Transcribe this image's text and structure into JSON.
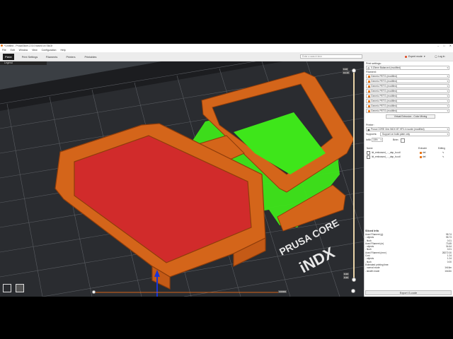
{
  "window": {
    "title": "*Untitled - PrusaSlicer-2.5.0 based on Slic3r",
    "controls": [
      "–",
      "□",
      "✕"
    ]
  },
  "menu": [
    "File",
    "Edit",
    "Window",
    "View",
    "Configuration",
    "Help"
  ],
  "tabs": [
    {
      "label": "Plater",
      "active": true
    },
    {
      "label": "Print Settings",
      "active": false
    },
    {
      "label": "Filaments",
      "active": false
    },
    {
      "label": "Printers",
      "active": false
    },
    {
      "label": "Printables",
      "active": false
    }
  ],
  "search": {
    "placeholder": "Enter a search term"
  },
  "mode": {
    "label": "Expert mode",
    "color": "#e0461d"
  },
  "login": {
    "label": "Log in"
  },
  "viewport": {
    "legend": "Legend",
    "bed_text_brand": "PRUSA CORE",
    "bed_text_model": "iNDX",
    "slider_top": "0.20",
    "slider_top2": "13.40",
    "slider_bottom": "0.20",
    "slider_bottom2": "0.20",
    "horizontal_value": "100000",
    "colors": {
      "bed": "#2a2c30",
      "grid": "#5a5d62",
      "part": "#d4651a",
      "fill": "#d12b2b",
      "support": "#3ee61a"
    }
  },
  "sidebar": {
    "print_settings_label": "Print settings:",
    "print_profile": "0.20mm Balanced (modified)",
    "filament_label": "Filament:",
    "filaments": [
      "Generic PETG (modified)",
      "Generic PETG (modified)",
      "Generic PETG (modified)",
      "Generic PETG (modified)",
      "Generic PETG (modified)",
      "Generic PETG (modified)",
      "Generic PETG (modified)",
      "Generic PETG (modified)"
    ],
    "virtual_extrusion_button": "Virtual Extrusion - Color Mixing",
    "printer_label": "Printer:",
    "printer_profile": "Prusa CORE One INDX 8T HF0.4 nozzle (modified)",
    "supports_label": "Supports:",
    "supports_value": "Support on build plate only",
    "infill_label": "Infill:",
    "infill_value": "15%",
    "brim_label": "Brim:",
    "objects_header": {
      "name": "Name",
      "extruder": "Extruder",
      "editing": "Editing"
    },
    "objects": [
      {
        "name": "lid_embossed_..._dap_bu.stl",
        "extruder": "def.",
        "extruder_color": "#e8771b"
      },
      {
        "name": "lid_embossed_..._dap_bu.stl",
        "extruder": "def.",
        "extruder_color": "#e8771b"
      }
    ]
  },
  "sliced_info": {
    "title": "Sliced Info",
    "rows": [
      {
        "label": "Used Filament (g)",
        "value": "98.74"
      },
      {
        "label": "- objects",
        "value": "98.73"
      },
      {
        "label": "- flush",
        "value": "0.01"
      },
      {
        "label": "Used Filament (m)",
        "value": "73.65"
      },
      {
        "label": "- objects",
        "value": "34.64"
      },
      {
        "label": "- flush",
        "value": "0.01"
      },
      {
        "label": "Used Filament (mm³)",
        "value": "28272.00"
      },
      {
        "label": "Cost",
        "value": "1.24"
      },
      {
        "label": "- objects",
        "value": "1.24"
      },
      {
        "label": "- flush",
        "value": "0.00"
      },
      {
        "label": "Estimated printing time:",
        "value": ""
      },
      {
        "label": "- normal mode",
        "value": "1h16m"
      },
      {
        "label": "- stealth mode",
        "value": "1h42m"
      }
    ]
  },
  "export_button": "Export G-code"
}
